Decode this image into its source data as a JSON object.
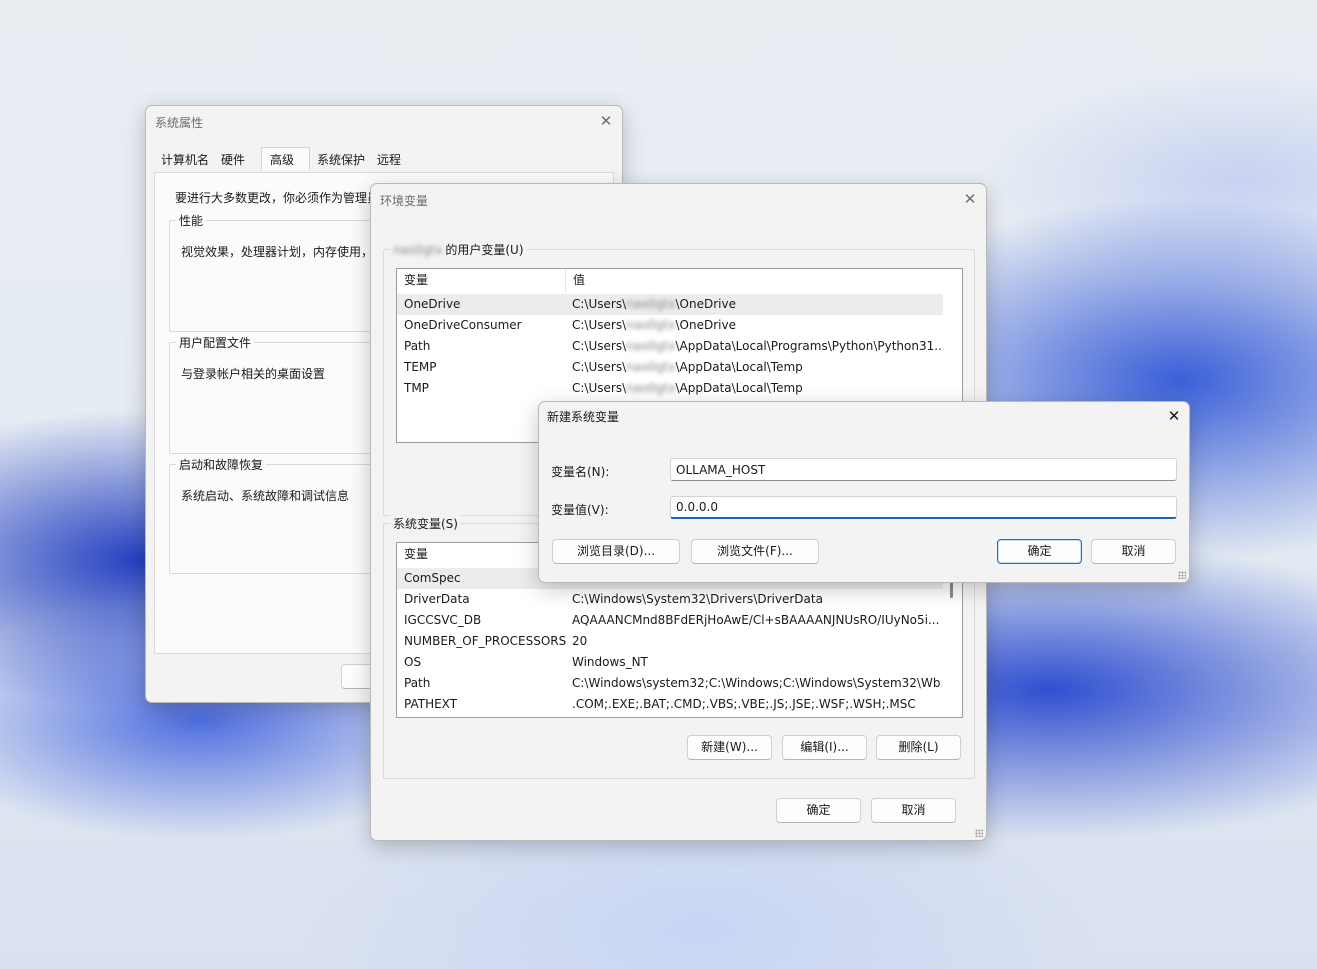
{
  "system_properties": {
    "title": "系统属性",
    "tabs": [
      "计算机名",
      "硬件",
      "高级",
      "系统保护",
      "远程"
    ],
    "admin_notice": "要进行大多数更改，你必须作为管理员",
    "performance": {
      "title": "性能",
      "desc": "视觉效果，处理器计划，内存使用，"
    },
    "user_profiles": {
      "title": "用户配置文件",
      "desc": "与登录帐户相关的桌面设置"
    },
    "startup_recovery": {
      "title": "启动和故障恢复",
      "desc": "系统启动、系统故障和调试信息"
    }
  },
  "env_vars": {
    "title": "环境变量",
    "user_section": {
      "username": "nao0gtx",
      "label": "的用户变量(U)"
    },
    "columns": {
      "name": "变量",
      "value": "值"
    },
    "user_vars": [
      {
        "name": "OneDrive",
        "pre": "C:\\Users\\",
        "user": "nao0gtx",
        "post": "\\OneDrive"
      },
      {
        "name": "OneDriveConsumer",
        "pre": "C:\\Users\\",
        "user": "nao0gtx",
        "post": "\\OneDrive"
      },
      {
        "name": "Path",
        "pre": "C:\\Users\\",
        "user": "nao0gtx",
        "post": "\\AppData\\Local\\Programs\\Python\\Python31..."
      },
      {
        "name": "TEMP",
        "pre": "C:\\Users\\",
        "user": "nao0gtx",
        "post": "\\AppData\\Local\\Temp"
      },
      {
        "name": "TMP",
        "pre": "C:\\Users\\",
        "user": "nao0gtx",
        "post": "\\AppData\\Local\\Temp"
      }
    ],
    "system_section_label": "系统变量(S)",
    "system_vars": [
      {
        "name": "ComSpec",
        "value": ""
      },
      {
        "name": "DriverData",
        "value": "C:\\Windows\\System32\\Drivers\\DriverData"
      },
      {
        "name": "IGCCSVC_DB",
        "value": "AQAAANCMnd8BFdERjHoAwE/Cl+sBAAAANJNUsRO/IUyNo5i..."
      },
      {
        "name": "NUMBER_OF_PROCESSORS",
        "value": "20"
      },
      {
        "name": "OS",
        "value": "Windows_NT"
      },
      {
        "name": "Path",
        "value": "C:\\Windows\\system32;C:\\Windows;C:\\Windows\\System32\\Wb..."
      },
      {
        "name": "PATHEXT",
        "value": ".COM;.EXE;.BAT;.CMD;.VBS;.VBE;.JS;.JSE;.WSF;.WSH;.MSC"
      }
    ],
    "buttons": {
      "new": "新建(W)...",
      "edit": "编辑(I)...",
      "delete": "删除(L)",
      "ok": "确定",
      "cancel": "取消"
    }
  },
  "new_system_var": {
    "title": "新建系统变量",
    "name_label": "变量名(N):",
    "name_value": "OLLAMA_HOST",
    "value_label": "变量值(V):",
    "value_value": "0.0.0.0",
    "buttons": {
      "browse_dir": "浏览目录(D)...",
      "browse_file": "浏览文件(F)...",
      "ok": "确定",
      "cancel": "取消"
    }
  }
}
